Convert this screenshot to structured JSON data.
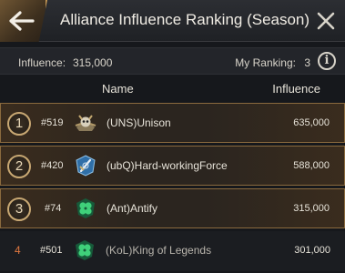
{
  "header": {
    "title": "Alliance Influence Ranking (Season)",
    "back_icon": "back-arrow-icon",
    "close_icon": "close-icon"
  },
  "summary": {
    "influence_label": "Influence:",
    "influence_value": "315,000",
    "my_ranking_label": "My Ranking:",
    "my_ranking_value": "3",
    "info_icon_glyph": "i"
  },
  "columns": {
    "name": "Name",
    "influence": "Influence"
  },
  "rows": [
    {
      "rank": "1",
      "id": "#519",
      "name": "(UNS)Unison",
      "influence": "635,000",
      "flag": "skull-banner-flag"
    },
    {
      "rank": "2",
      "id": "#420",
      "name": "(ubQ)Hard-workingForce",
      "influence": "588,000",
      "flag": "blue-sword-flag"
    },
    {
      "rank": "3",
      "id": "#74",
      "name": "(Ant)Antify",
      "influence": "315,000",
      "flag": "green-clover-flag"
    },
    {
      "rank": "4",
      "id": "#501",
      "name": "(KoL)King of Legends",
      "influence": "301,000",
      "flag": "green-clover-flag"
    }
  ],
  "colors": {
    "accent_gold": "#c8a873",
    "rank_plain": "#e07840",
    "background": "#16181c"
  }
}
